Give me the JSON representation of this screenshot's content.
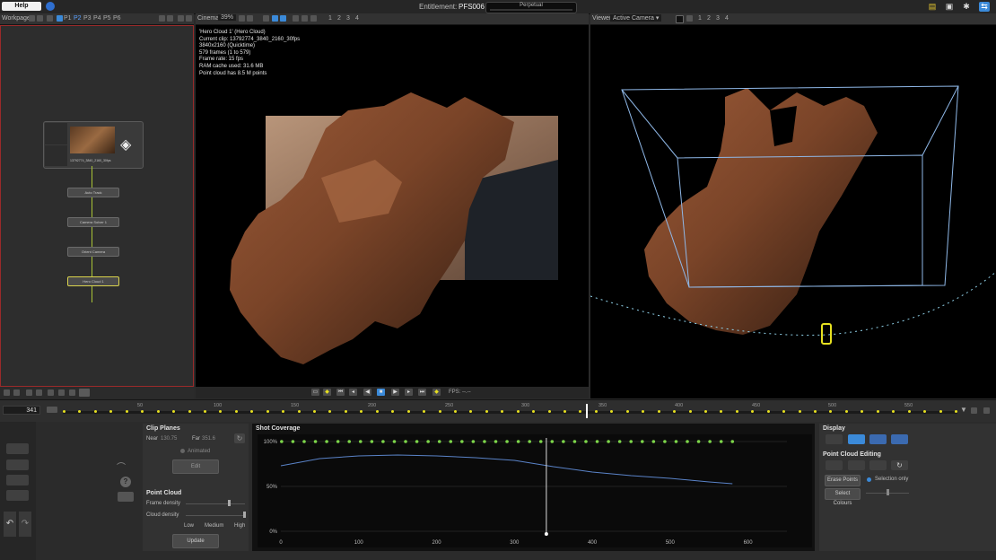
{
  "topbar": {
    "help_label": "Help",
    "entitlement_label": "Entitlement:",
    "entitlement_value": "PFS006",
    "license_label": "Perpetual"
  },
  "workpage": {
    "title": "Workpage",
    "pages": [
      "P1",
      "P2",
      "P3",
      "P4",
      "P5",
      "P6"
    ],
    "clip_node_label": "13792774_3840_2160_30fps",
    "nodes": [
      "Auto Track",
      "Camera Solver 1",
      "Orient Camera",
      "Hero Cloud 1"
    ]
  },
  "cinema": {
    "title": "Cinema",
    "zoom": "39%",
    "tabs": [
      "1",
      "2",
      "3",
      "4"
    ],
    "info_lines": [
      "'Hero Cloud 1' (Hero Cloud)",
      "Current clip: 13792774_3840_2160_30fps",
      "3840x2160 (Quicktime)",
      "579 frames (1 to 579)",
      "Frame rate: 15 fps",
      "RAM cache used: 31.6 MB",
      "Point cloud has 8.5 M points"
    ],
    "fps_label": "FPS: --.--"
  },
  "viewer": {
    "title": "Viewer",
    "camera_select": "Active Camera",
    "tabs": [
      "1",
      "2",
      "3",
      "4"
    ]
  },
  "timeline": {
    "current_frame": "341",
    "ticks": [
      "50",
      "100",
      "150",
      "200",
      "250",
      "300",
      "350",
      "400",
      "450",
      "500",
      "550"
    ],
    "playhead_frame": 341,
    "range": [
      1,
      579
    ]
  },
  "clip_planes": {
    "title": "Clip Planes",
    "near_label": "Near",
    "near_value": "130.75",
    "far_label": "Far",
    "far_value": "351.6",
    "animated_label": "Animated",
    "edit_label": "Edit"
  },
  "point_cloud": {
    "title": "Point Cloud",
    "frame_density_label": "Frame density",
    "cloud_density_label": "Cloud density",
    "density_levels": [
      "Low",
      "Medium",
      "High"
    ],
    "update_label": "Update"
  },
  "shot_coverage": {
    "title": "Shot Coverage"
  },
  "display": {
    "title": "Display",
    "editing_title": "Point Cloud Editing",
    "erase_label": "Erase Points",
    "selection_only_label": "Selection only",
    "select_colours_label": "Select Colours"
  },
  "colors": {
    "accent": "#3b8ad9",
    "track_green": "#7dd64a",
    "keyframe_yellow": "#e6e020",
    "selection_yellow": "#d9d24c",
    "bounding_box": "#8fb8e8",
    "coverage_curve": "#5a83c8"
  },
  "chart_data": {
    "type": "line",
    "title": "Shot Coverage",
    "xlabel": "",
    "ylabel": "",
    "xlim": [
      0,
      650
    ],
    "ylim": [
      0,
      100
    ],
    "x_ticks": [
      "0",
      "100",
      "200",
      "300",
      "400",
      "500",
      "600"
    ],
    "y_ticks": [
      "0%",
      "50%",
      "100%"
    ],
    "series": [
      {
        "x": [
          0,
          50,
          100,
          150,
          200,
          250,
          300,
          350,
          400,
          450,
          500,
          550,
          580
        ],
        "y": [
          73,
          81,
          84,
          85,
          84,
          82,
          79,
          72,
          66,
          62,
          59,
          55,
          53
        ]
      }
    ],
    "marker_row_y": 100,
    "playhead_x": 341
  }
}
